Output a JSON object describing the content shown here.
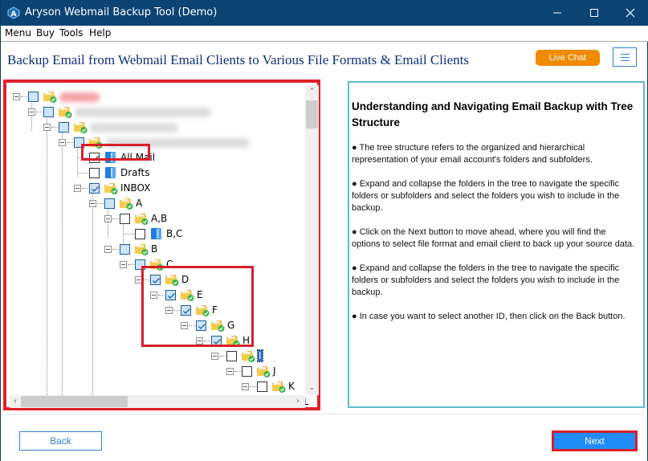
{
  "window": {
    "title": "Aryson Webmail Backup Tool (Demo)",
    "controls": [
      "minimize",
      "maximize",
      "close"
    ]
  },
  "menubar": {
    "items": [
      "Menu",
      "Buy",
      "Tools",
      "Help"
    ]
  },
  "header": {
    "title": "Backup Email from Webmail Email Clients to Various File Formats & Email Clients",
    "live_chat_label": "Live Chat",
    "menu_icon": "hamburger-icon"
  },
  "tree": {
    "nodes": [
      {
        "level": 0,
        "label": "",
        "redacted": true,
        "expander": true,
        "check": "partial",
        "icon": "folder-check-icon"
      },
      {
        "level": 1,
        "label": "",
        "redacted": true,
        "expander": true,
        "check": "partial",
        "icon": "folder-check-icon"
      },
      {
        "level": 2,
        "label": "",
        "redacted": true,
        "expander": true,
        "check": "partial",
        "icon": "folder-check-icon"
      },
      {
        "level": 3,
        "label": "",
        "redacted": true,
        "expander": true,
        "check": "partial",
        "icon": "folder-check-icon"
      },
      {
        "level": 4,
        "label": "All Mail",
        "expander": false,
        "check": "checked-plain",
        "icon": "mail-folder-icon",
        "highlighted": true
      },
      {
        "level": 4,
        "label": "Drafts",
        "expander": false,
        "check": "unchecked",
        "icon": "mail-folder-icon"
      },
      {
        "level": 4,
        "label": "INBOX",
        "expander": true,
        "check": "checked",
        "icon": "folder-check-icon"
      },
      {
        "level": 5,
        "label": "A",
        "expander": true,
        "check": "partial",
        "icon": "folder-check-icon"
      },
      {
        "level": 6,
        "label": "A,B",
        "expander": true,
        "check": "unchecked",
        "icon": "folder-check-icon"
      },
      {
        "level": 7,
        "label": "B,C",
        "expander": false,
        "check": "unchecked",
        "icon": "mail-folder-icon"
      },
      {
        "level": 6,
        "label": "B",
        "expander": true,
        "check": "partial",
        "icon": "folder-check-icon"
      },
      {
        "level": 7,
        "label": "C",
        "expander": true,
        "check": "partial",
        "icon": "folder-check-icon"
      },
      {
        "level": 8,
        "label": "D",
        "expander": true,
        "check": "checked",
        "icon": "folder-check-icon",
        "highlighted": true
      },
      {
        "level": 9,
        "label": "E",
        "expander": true,
        "check": "checked",
        "icon": "folder-check-icon",
        "highlighted": true
      },
      {
        "level": 10,
        "label": "F",
        "expander": true,
        "check": "checked",
        "icon": "folder-check-icon",
        "highlighted": true
      },
      {
        "level": 11,
        "label": "G",
        "expander": true,
        "check": "checked",
        "icon": "folder-check-icon",
        "highlighted": true
      },
      {
        "level": 12,
        "label": "H",
        "expander": true,
        "check": "checked",
        "icon": "folder-check-icon",
        "highlighted": true
      },
      {
        "level": 13,
        "label": "I",
        "expander": true,
        "check": "unchecked",
        "icon": "folder-check-icon",
        "selected": true
      },
      {
        "level": 14,
        "label": "J",
        "expander": true,
        "check": "unchecked",
        "icon": "folder-check-icon"
      },
      {
        "level": 15,
        "label": "K",
        "expander": true,
        "check": "unchecked",
        "icon": "folder-check-icon"
      },
      {
        "level": 16,
        "label": "L",
        "expander": true,
        "check": "unchecked",
        "icon": "folder-check-icon"
      }
    ]
  },
  "info": {
    "title": "Understanding and Navigating Email Backup with Tree Structure",
    "bullets": [
      "● The tree structure refers to the organized and hierarchical representation of your email account's folders and subfolders.",
      "● Expand and collapse the folders in the tree to navigate the specific folders or subfolders and select the folders you wish to include in the backup.",
      "● Click on the Next button to move ahead, where you will find the options to select file format and email client to back up your source data.",
      "● Expand and collapse the folders in the tree to navigate the specific folders or subfolders and select the folders you wish to include in the backup.",
      "● In case you want to select another ID, then click on the Back button."
    ]
  },
  "footer": {
    "back_label": "Back",
    "next_label": "Next"
  },
  "colors": {
    "titlebar": "#0b4373",
    "accent_blue": "#1f8cf7",
    "highlight_red": "#d71f2a",
    "live_chat_orange": "#f08a00",
    "info_border": "#5bbcd0",
    "heading_navy": "#0d2f77"
  }
}
